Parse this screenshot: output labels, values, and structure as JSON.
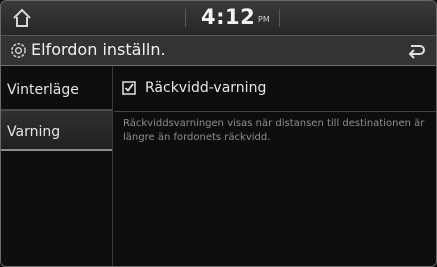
{
  "status_bar": {
    "time": "4:12",
    "ampm": "PM"
  },
  "header": {
    "title": "Elfordon inställn."
  },
  "sidebar": {
    "items": [
      {
        "label": "Vinterläge"
      },
      {
        "label": "Varning",
        "active": true
      }
    ]
  },
  "content": {
    "option": {
      "label": "Räckvidd-varning",
      "checked": true
    },
    "description": "Räckviddsvarningen visas när distansen till destinationen är längre än fordonets räckvidd."
  },
  "icons": {
    "home": "home-icon",
    "settings": "gear-icon",
    "back": "back-icon",
    "checkbox": "checkbox-checked-icon"
  }
}
